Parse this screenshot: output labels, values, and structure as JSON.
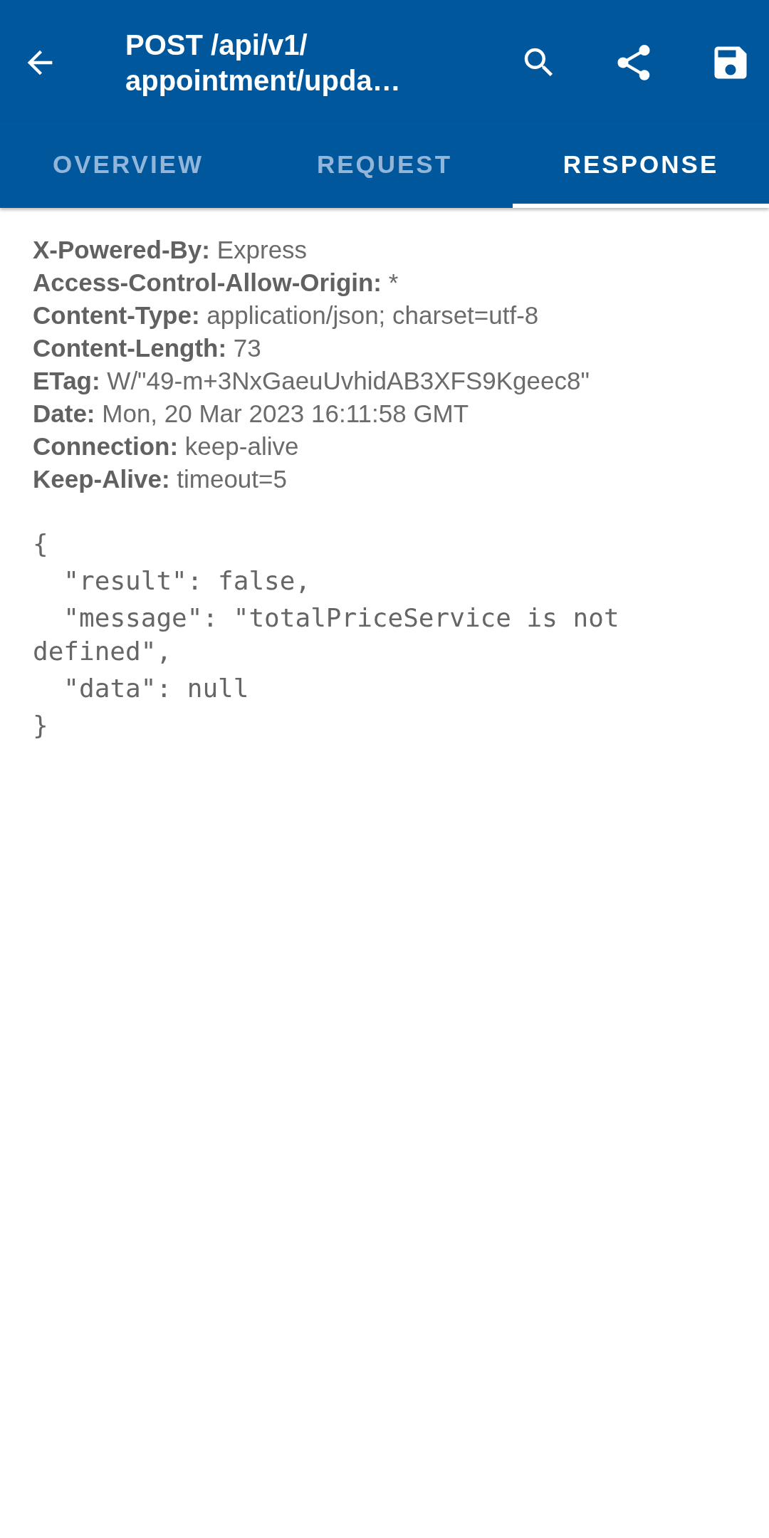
{
  "app_bar": {
    "title_lines": [
      "POST /api/v1/",
      "appointment/upda…"
    ]
  },
  "tabs": [
    {
      "label": "OVERVIEW",
      "selected": false
    },
    {
      "label": "REQUEST",
      "selected": false
    },
    {
      "label": "RESPONSE",
      "selected": true
    }
  ],
  "headers": [
    {
      "name": "X-Powered-By:",
      "value": "Express"
    },
    {
      "name": "Access-Control-Allow-Origin:",
      "value": "*"
    },
    {
      "name": "Content-Type:",
      "value": "application/json; charset=utf-8"
    },
    {
      "name": "Content-Length:",
      "value": "73"
    },
    {
      "name": "ETag:",
      "value": "W/\"49-m+3NxGaeuUvhidAB3XFS9Kgeec8\""
    },
    {
      "name": "Date:",
      "value": "Mon, 20 Mar 2023 16:11:58 GMT"
    },
    {
      "name": "Connection:",
      "value": "keep-alive"
    },
    {
      "name": "Keep-Alive:",
      "value": "timeout=5"
    }
  ],
  "body_lines": [
    "{",
    "  \"result\": false,",
    "  \"message\": \"totalPriceService is not defined\",",
    "  \"data\": null",
    "}"
  ]
}
